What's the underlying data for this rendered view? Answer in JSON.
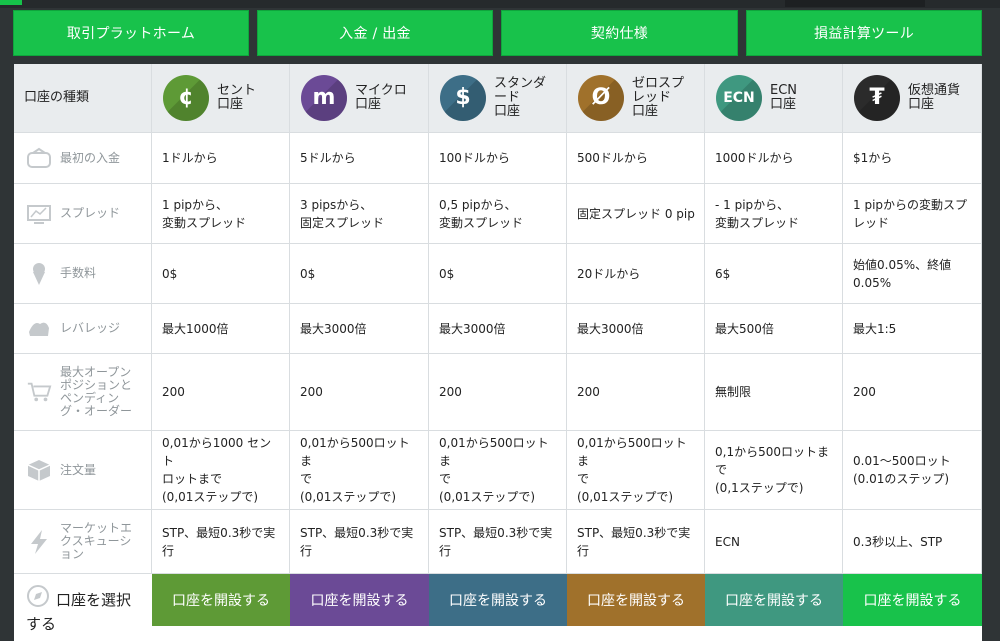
{
  "tabs": [
    "取引プラットホーム",
    "入金 / 出金",
    "契約仕様",
    "損益計算ツール"
  ],
  "header": {
    "account_type_label": "口座の種類",
    "accounts": [
      {
        "name": "セント\n口座",
        "icon": "cent-icon",
        "glyph": "¢",
        "color": "#5e9a36"
      },
      {
        "name": "マイクロ\n口座",
        "icon": "micro-icon",
        "glyph": "m",
        "color": "#6b4a96"
      },
      {
        "name": "スタンダ\nード\n口座",
        "icon": "standard-icon",
        "glyph": "$",
        "color": "#3d6e87"
      },
      {
        "name": "ゼロスプ\nレッド\n口座",
        "icon": "zero-spread-icon",
        "glyph": "Ø",
        "color": "#a0712b"
      },
      {
        "name": "ECN\n口座",
        "icon": "ecn-icon",
        "glyph": "ECN",
        "color": "#3f9880"
      },
      {
        "name": "仮想通貨\n口座",
        "icon": "tether-icon",
        "glyph": "₮",
        "color": "#2b2b2b"
      }
    ]
  },
  "rows": [
    {
      "label": "最初の入金",
      "icon": "wallet-icon",
      "values": [
        "1ドルから",
        "5ドルから",
        "100ドルから",
        "500ドルから",
        "1000ドルから",
        "$1から"
      ]
    },
    {
      "label": "スプレッド",
      "icon": "chart-screen-icon",
      "values": [
        "1 pipから、\n変動スプレッド",
        "3 pipsから、\n固定スプレッド",
        "0,5 pipから、\n変動スプレッド",
        "固定スプレッド 0 pip",
        "- 1 pipから、\n変動スプレッド",
        "1 pipからの変動スプ\nレッド"
      ]
    },
    {
      "label": "手数料",
      "icon": "ice-cream-icon",
      "values": [
        "0$",
        "0$",
        "0$",
        "20ドルから",
        "6$",
        "始値0.05%、終値\n0.05%"
      ]
    },
    {
      "label": "レバレッジ",
      "icon": "muscle-icon",
      "values": [
        "最大1000倍",
        "最大3000倍",
        "最大3000倍",
        "最大3000倍",
        "最大500倍",
        "最大1:5"
      ]
    },
    {
      "label": "最大オープン\nポジションと\nペンディン\nグ・オーダー",
      "icon": "cart-icon",
      "values": [
        "200",
        "200",
        "200",
        "200",
        "無制限",
        "200"
      ]
    },
    {
      "label": "注文量",
      "icon": "box-icon",
      "values": [
        "0,01から1000 セント\nロットまで\n(0,01ステップで)",
        "0,01から500ロットま\nで\n(0,01ステップで)",
        "0,01から500ロットま\nで\n(0,01ステップで)",
        "0,01から500ロットま\nで\n(0,01ステップで)",
        "0,1から500ロットま\nで\n(0,1ステップで)",
        "0.01～500ロット\n(0.01のステップ)"
      ]
    },
    {
      "label": "マーケットエ\nクスキューシ\nョン",
      "icon": "lightning-icon",
      "values": [
        "STP、最短0.3秒で実\n行",
        "STP、最短0.3秒で実\n行",
        "STP、最短0.3秒で実\n行",
        "STP、最短0.3秒で実\n行",
        "ECN",
        "0.3秒以上、STP"
      ]
    }
  ],
  "footer": {
    "select_label": "口座を選択\nする",
    "select_icon": "compass-icon",
    "open_label": "口座を開設する",
    "open_colors": [
      "#5e9a36",
      "#6b4a96",
      "#3d6e87",
      "#a0712b",
      "#3f9880",
      "#18c24b"
    ]
  }
}
